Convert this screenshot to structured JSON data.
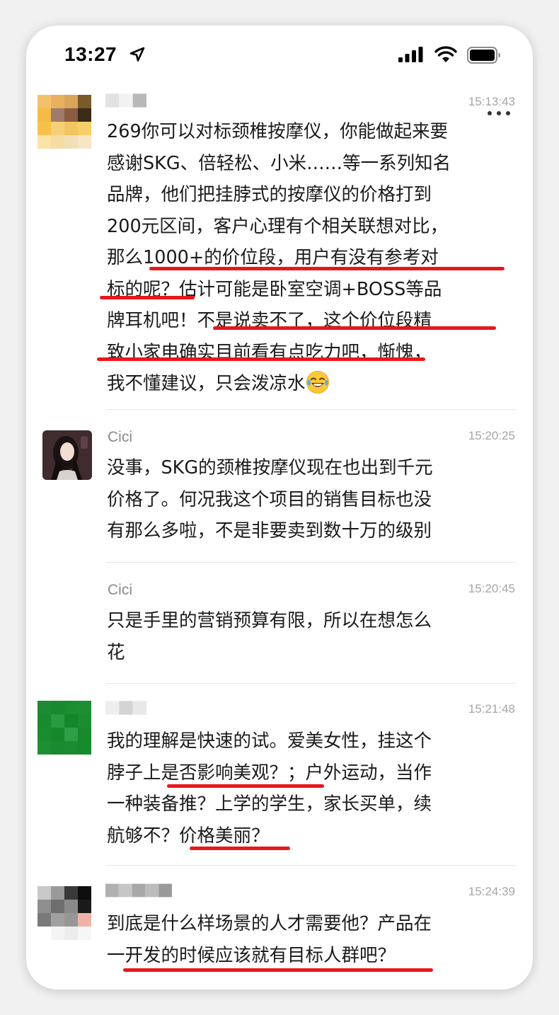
{
  "status_bar": {
    "time": "13:27"
  },
  "messages": [
    {
      "sender": "",
      "time": "15:13:43",
      "lines": [
        "269你可以对标颈椎按摩仪，你能做起来要",
        "感谢SKG、倍轻松、小米……等一系列知名",
        "品牌，他们把挂脖式的按摩仪的价格打到",
        "200元区间，客户心理有个相关联想对比，",
        "那么1000+的价位段，用户有没有参考对",
        "标的呢？估计可能是卧室空调+BOSS等品",
        "牌耳机吧！不是说卖不了，这个价位段精",
        "致小家电确实目前看有点吃力吧，惭愧，",
        "我不懂建议，只会泼凉水"
      ]
    },
    {
      "sender": "Cici",
      "time": "15:20:25",
      "lines": [
        "没事，SKG的颈椎按摩仪现在也出到千元",
        "价格了。何况我这个项目的销售目标也没",
        "有那么多啦，不是非要卖到数十万的级别"
      ]
    },
    {
      "sender": "Cici",
      "time": "15:20:45",
      "lines": [
        "只是手里的营销预算有限，所以在想怎么",
        "花"
      ]
    },
    {
      "sender": "",
      "time": "15:21:48",
      "lines": [
        "我的理解是快速的试。爱美女性，挂这个",
        "脖子上是否影响美观？；户外运动，当作",
        "一种装备推？上学的学生，家长买单，续",
        "航够不？价格美丽？"
      ]
    },
    {
      "sender": "",
      "time": "15:24:39",
      "lines": [
        "到底是什么样场景的人才需要他？产品在",
        "一开发的时候应该就有目标人群吧？"
      ]
    }
  ],
  "colors": {
    "underline": "#e8171b",
    "text": "#1a1a1a",
    "meta": "#a5a5a5"
  },
  "icons": [
    "location-arrow-icon",
    "cellular-signal-icon",
    "wifi-icon",
    "battery-icon",
    "more-icon",
    "laughing-tears-emoji-icon"
  ]
}
